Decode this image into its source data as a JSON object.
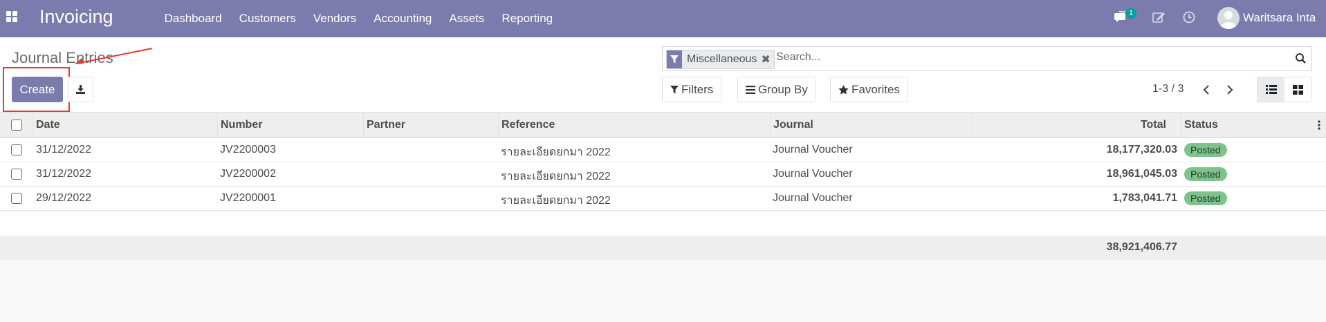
{
  "navbar": {
    "app_title": "Invoicing",
    "menu": [
      "Dashboard",
      "Customers",
      "Vendors",
      "Accounting",
      "Assets",
      "Reporting"
    ],
    "messages_count": "1",
    "user_name": "Waritsara Inta"
  },
  "control_panel": {
    "title": "Journal Entries",
    "create_label": "Create",
    "search": {
      "facet": "Miscellaneous",
      "placeholder": "Search..."
    },
    "filters_label": "Filters",
    "group_by_label": "Group By",
    "favorites_label": "Favorites",
    "pager": "1-3 / 3"
  },
  "table": {
    "columns": [
      "Date",
      "Number",
      "Partner",
      "Reference",
      "Journal",
      "Total",
      "Status"
    ],
    "rows": [
      {
        "date": "31/12/2022",
        "number": "JV2200003",
        "partner": "",
        "reference": "รายละเอียดยกมา 2022",
        "journal": "Journal Voucher",
        "total": "18,177,320.03",
        "status": "Posted"
      },
      {
        "date": "31/12/2022",
        "number": "JV2200002",
        "partner": "",
        "reference": "รายละเอียดยกมา 2022",
        "journal": "Journal Voucher",
        "total": "18,961,045.03",
        "status": "Posted"
      },
      {
        "date": "29/12/2022",
        "number": "JV2200001",
        "partner": "",
        "reference": "รายละเอียดยกมา 2022",
        "journal": "Journal Voucher",
        "total": "1,783,041.71",
        "status": "Posted"
      }
    ],
    "footer_total": "38,921,406.77"
  },
  "colors": {
    "brand": "#7c7bad",
    "status_posted": "#7ec38c",
    "annotation": "#e53935"
  }
}
